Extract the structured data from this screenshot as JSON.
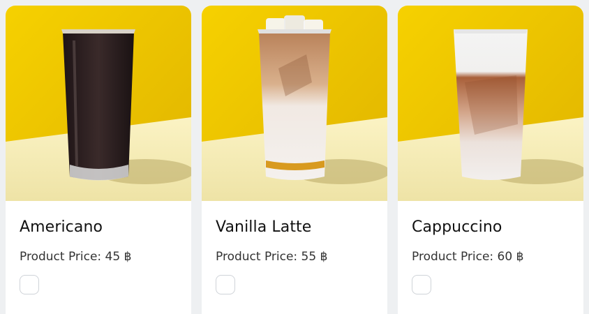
{
  "products": [
    {
      "name": "Americano",
      "price_text": "Product Price: 45 ฿",
      "price": 45,
      "currency": "฿",
      "image_icon": "iced-americano-glass-icon",
      "selected": false
    },
    {
      "name": "Vanilla Latte",
      "price_text": "Product Price: 55 ฿",
      "price": 55,
      "currency": "฿",
      "image_icon": "iced-vanilla-latte-glass-icon",
      "selected": false
    },
    {
      "name": "Cappuccino",
      "price_text": "Product Price: 60 ฿",
      "price": 60,
      "currency": "฿",
      "image_icon": "iced-cappuccino-glass-icon",
      "selected": false
    }
  ],
  "colors": {
    "backdrop_yellow": "#f2c400",
    "table_cream": "#f7efb8",
    "page_background": "#eef0f2"
  }
}
